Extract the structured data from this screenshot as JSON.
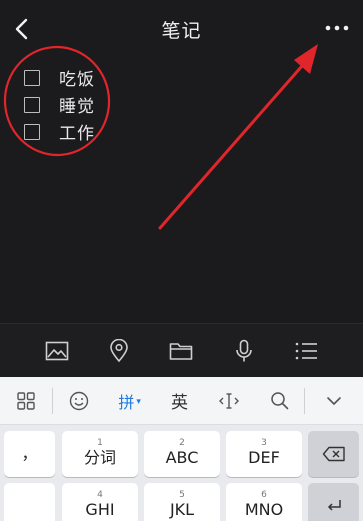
{
  "header": {
    "title": "笔记"
  },
  "checklist": [
    {
      "label": "吃饭",
      "checked": false
    },
    {
      "label": "睡觉",
      "checked": false
    },
    {
      "label": "工作",
      "checked": false
    }
  ],
  "annotation": {
    "color": "#e0262b",
    "shapes": [
      "red circle around checklist",
      "red arrow pointing to more-options icon"
    ]
  },
  "toolbar_icons": [
    "image-icon",
    "location-icon",
    "folder-icon",
    "microphone-icon",
    "list-icon"
  ],
  "keyboard": {
    "bar": {
      "pinyin_label": "拼",
      "english_label": "英"
    },
    "keys": {
      "punct": "，",
      "k1_num": "1",
      "k1_label": "分词",
      "k2_num": "2",
      "k2_label": "ABC",
      "k3_num": "3",
      "k3_label": "DEF",
      "k4_num": "4",
      "k4_label": "GHI",
      "k5_num": "5",
      "k5_label": "JKL",
      "k6_num": "6",
      "k6_label": "MNO"
    }
  },
  "colors": {
    "background": "#1b1b1d",
    "pinyin_accent": "#1f7be0"
  }
}
